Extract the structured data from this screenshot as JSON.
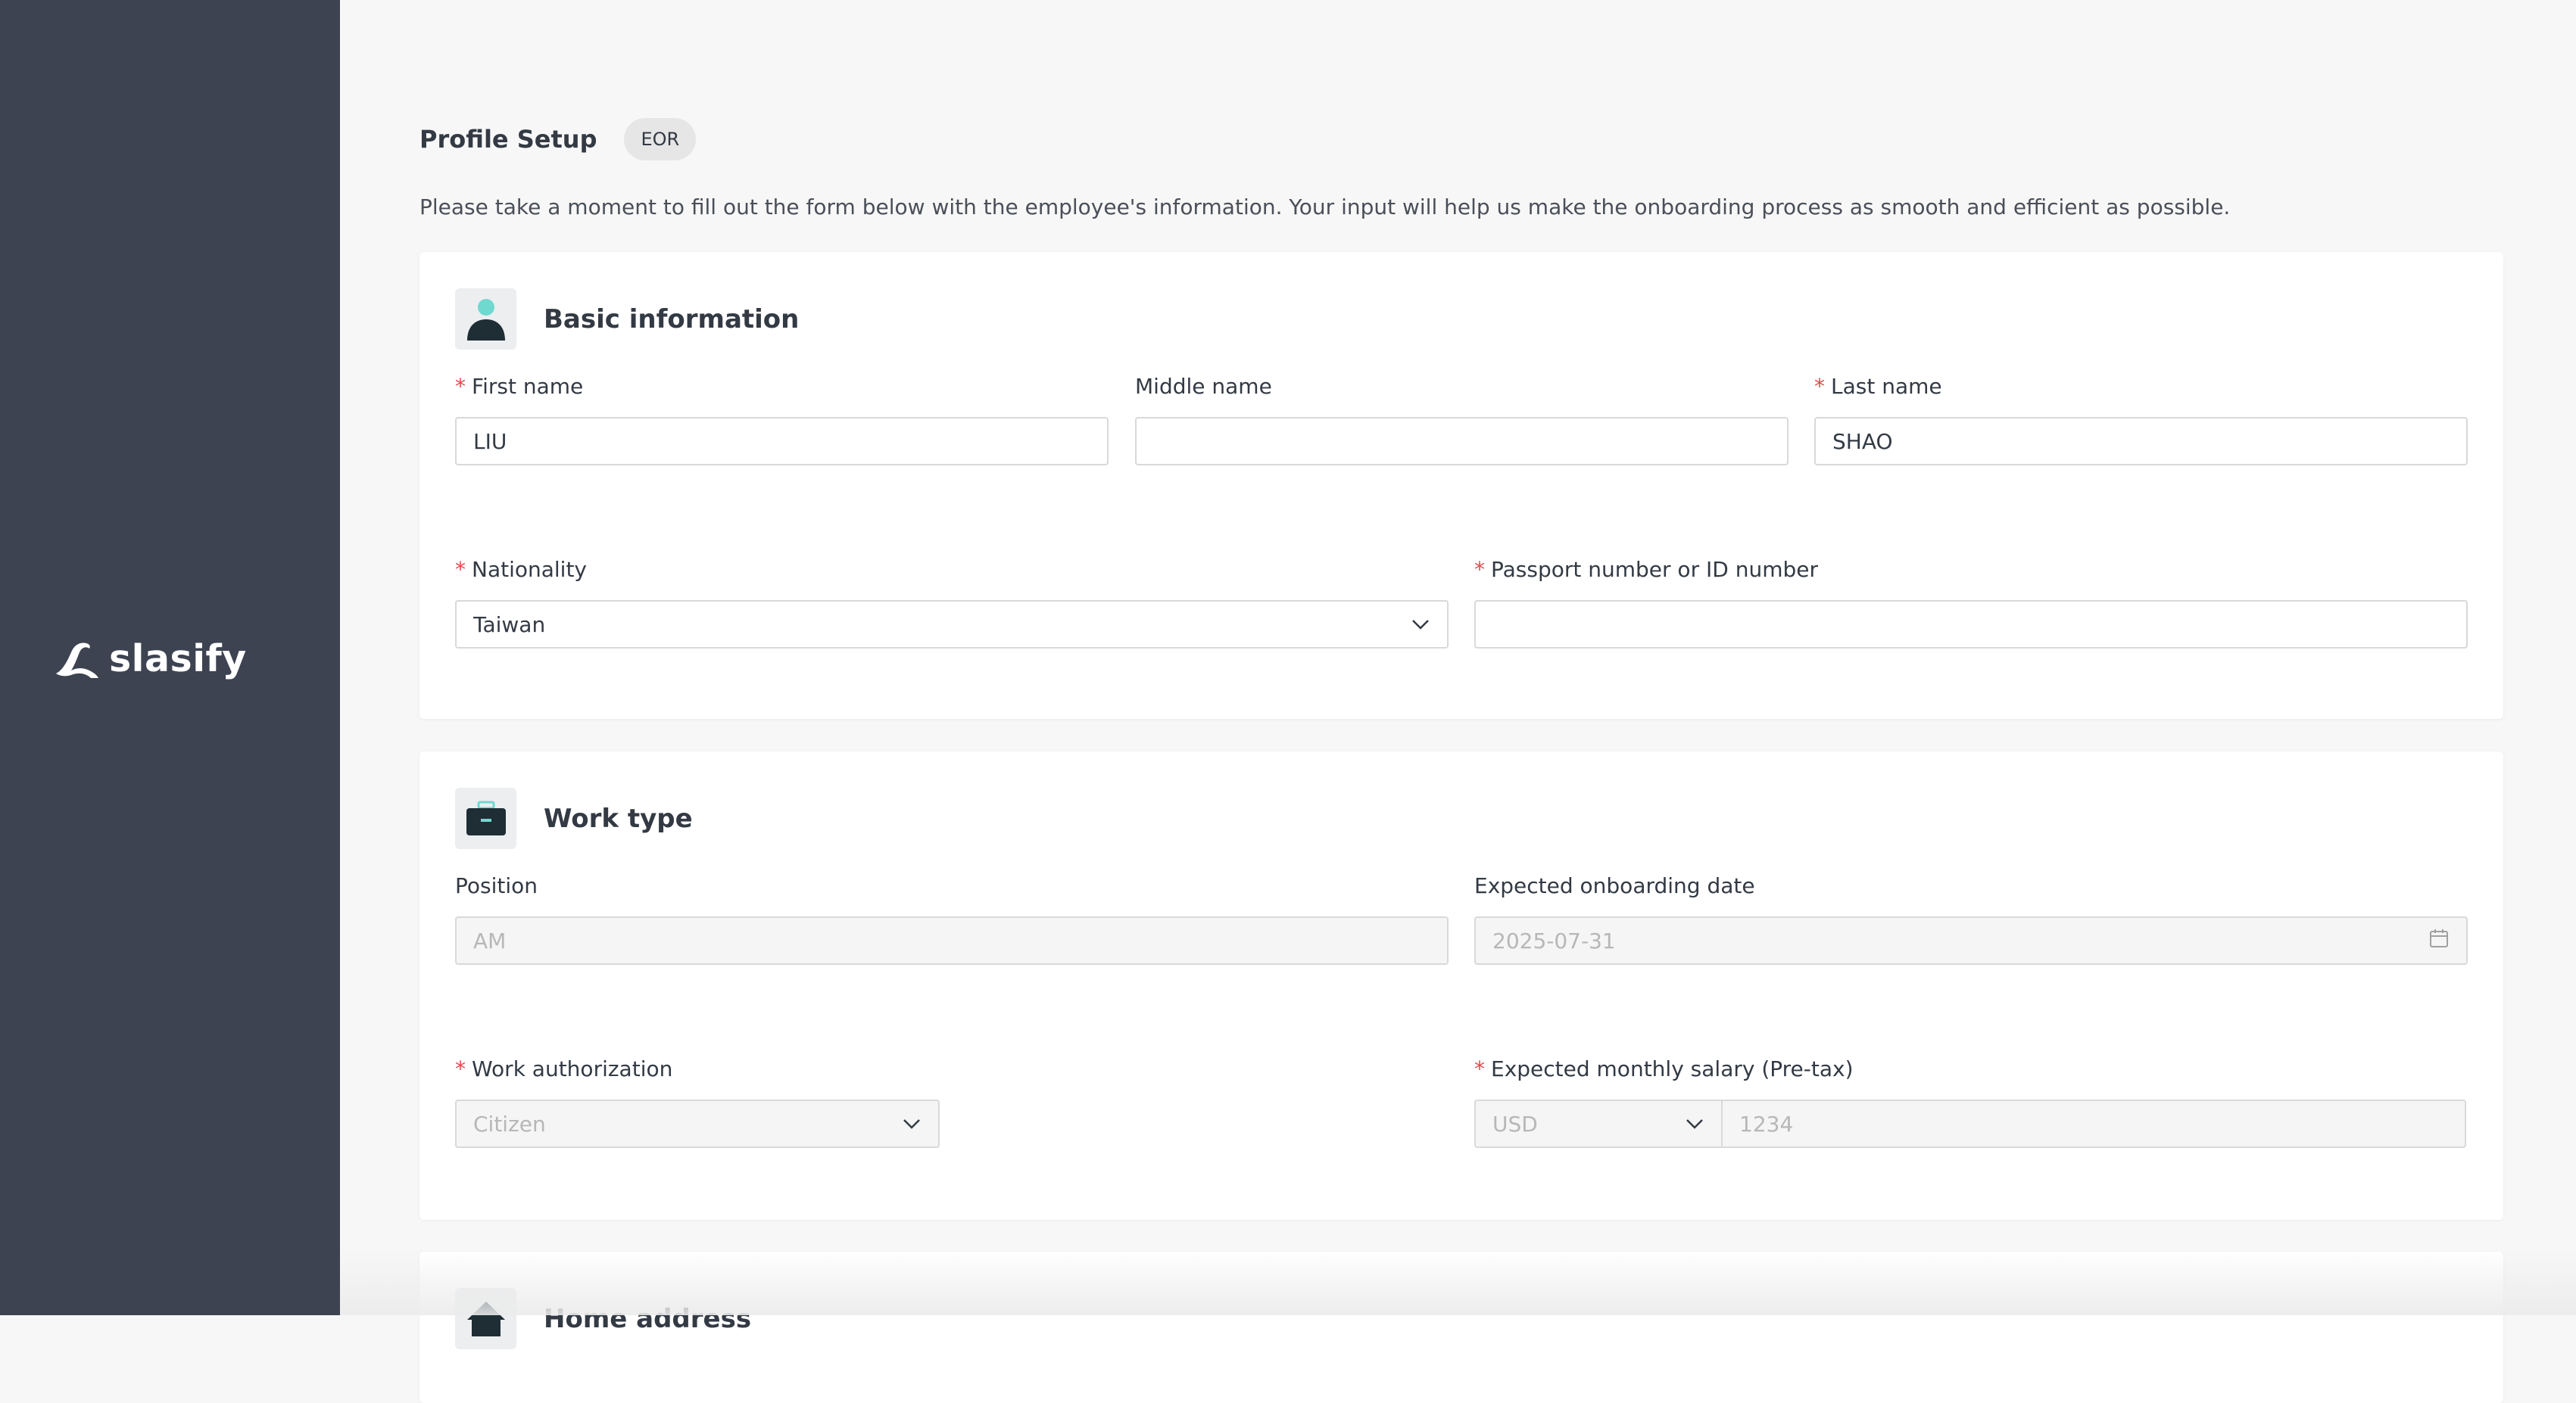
{
  "brand": {
    "name": "slasify"
  },
  "page": {
    "title": "Profile Setup",
    "badge": "EOR",
    "intro": "Please take a moment to fill out the form below with the employee's information. Your input will help us make the onboarding process as smooth and efficient as possible."
  },
  "basic": {
    "title": "Basic information",
    "first_name": {
      "label": "First name",
      "value": "LIU",
      "required": "*"
    },
    "middle_name": {
      "label": "Middle name",
      "value": ""
    },
    "last_name": {
      "label": "Last name",
      "value": "SHAO",
      "required": "*"
    },
    "nationality": {
      "label": "Nationality",
      "value": "Taiwan",
      "required": "*"
    },
    "passport": {
      "label": "Passport number or ID number",
      "value": "",
      "required": "*"
    }
  },
  "work": {
    "title": "Work type",
    "position": {
      "label": "Position",
      "value": "AM"
    },
    "onboarding_date": {
      "label": "Expected onboarding date",
      "value": "2025-07-31"
    },
    "authorization": {
      "label": "Work authorization",
      "value": "Citizen",
      "required": "*"
    },
    "salary": {
      "label": "Expected monthly salary (Pre-tax)",
      "currency": "USD",
      "amount": "1234",
      "required": "*"
    }
  },
  "home": {
    "title": "Home address"
  },
  "icons": {
    "person": "person-icon",
    "briefcase": "briefcase-icon",
    "home": "home-icon",
    "chevron": "chevron-down-icon",
    "calendar": "calendar-icon"
  },
  "colors": {
    "sidebar": "#3d4350",
    "accent": "#6fd8cf",
    "icon_dark": "#1f2d35",
    "required": "#e5484d"
  }
}
